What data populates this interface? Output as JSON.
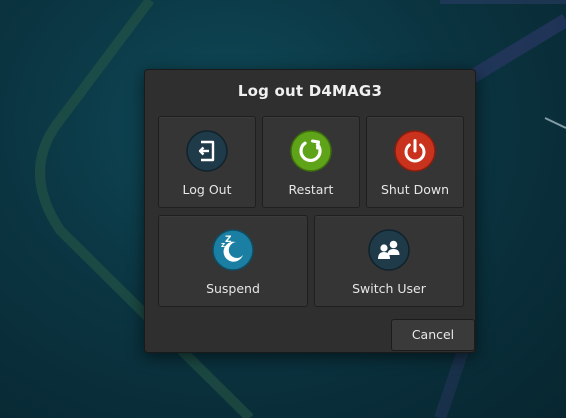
{
  "dialog": {
    "title": "Log out D4MAG3"
  },
  "actions": [
    {
      "label": "Log Out",
      "icon": "log-out-icon",
      "color": "#1f3a48"
    },
    {
      "label": "Restart",
      "icon": "restart-icon",
      "color": "#5fa319"
    },
    {
      "label": "Shut Down",
      "icon": "shut-down-icon",
      "color": "#c9321c"
    },
    {
      "label": "Suspend",
      "icon": "suspend-icon",
      "color": "#1b7fa3"
    },
    {
      "label": "Switch User",
      "icon": "switch-user-icon",
      "color": "#1f3a48"
    }
  ],
  "cancel_label": "Cancel"
}
